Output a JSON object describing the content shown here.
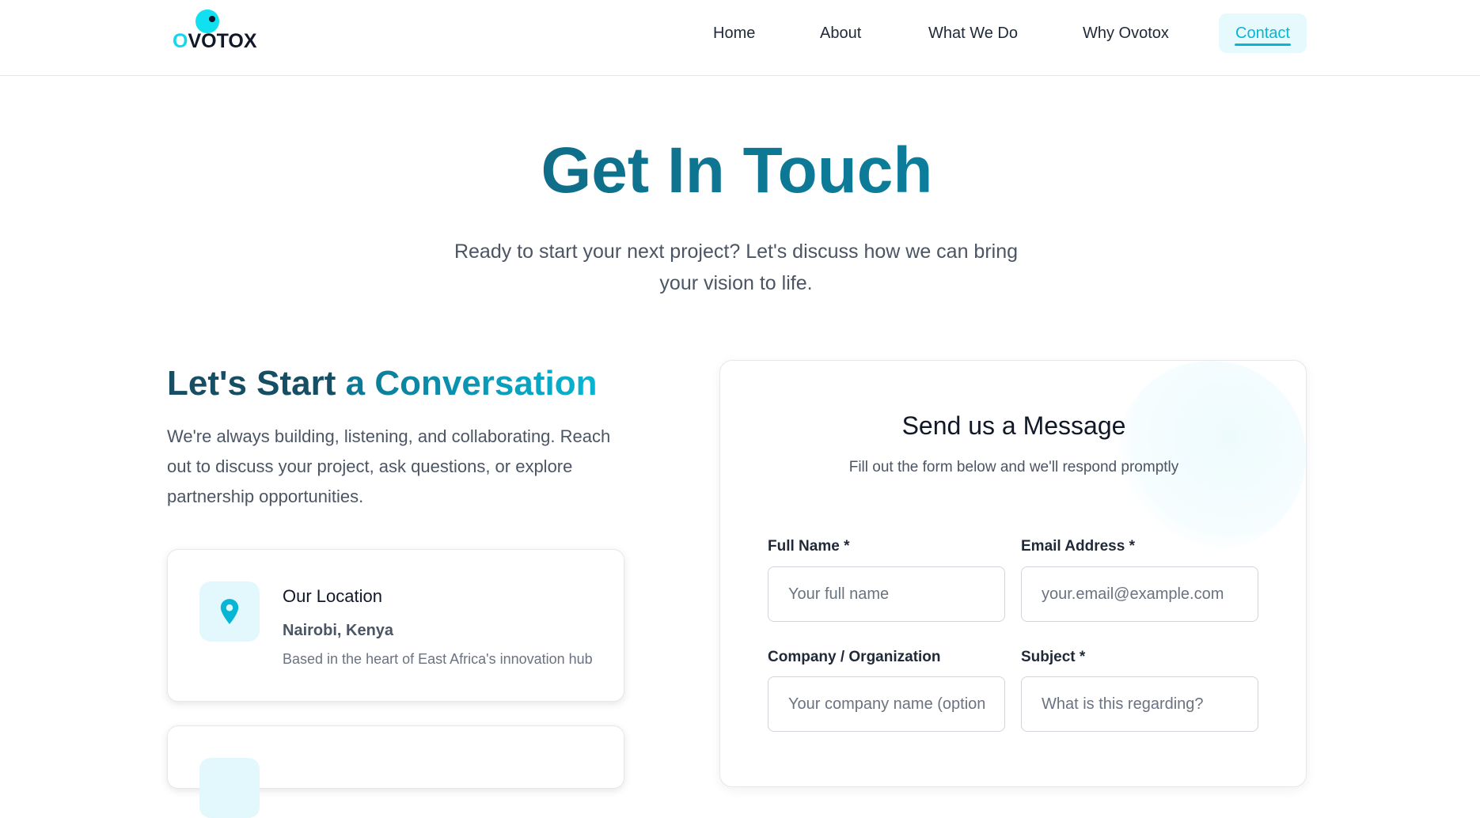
{
  "brand": {
    "logo_first_letter": "O",
    "logo_rest": "VOTOX",
    "accent_color": "#06b6d4",
    "dark_color": "#164e63"
  },
  "nav": {
    "items": [
      {
        "label": "Home"
      },
      {
        "label": "About"
      },
      {
        "label": "What We Do"
      },
      {
        "label": "Why Ovotox"
      },
      {
        "label": "Contact",
        "active": true
      }
    ]
  },
  "hero": {
    "title": "Get In Touch",
    "subtitle": "Ready to start your next project? Let's discuss how we can bring your vision to life."
  },
  "left": {
    "heading_part1": "Let's Start",
    "heading_part2": " a Conversation",
    "text": "We're always building, listening, and collaborating. Reach out to discuss your project, ask questions, or explore partnership opportunities.",
    "cards": [
      {
        "icon": "map-pin-icon",
        "title": "Our Location",
        "main": "Nairobi, Kenya",
        "desc": "Based in the heart of East Africa's innovation hub"
      }
    ]
  },
  "form": {
    "title": "Send us a Message",
    "subtitle": "Fill out the form below and we'll respond promptly",
    "fields": {
      "full_name": {
        "label": "Full Name *",
        "placeholder": "Your full name",
        "value": ""
      },
      "email": {
        "label": "Email Address *",
        "placeholder": "your.email@example.com",
        "value": ""
      },
      "company": {
        "label": "Company / Organization",
        "placeholder": "Your company name (optional)",
        "value": ""
      },
      "subject": {
        "label": "Subject *",
        "placeholder": "What is this regarding?",
        "value": ""
      }
    }
  }
}
